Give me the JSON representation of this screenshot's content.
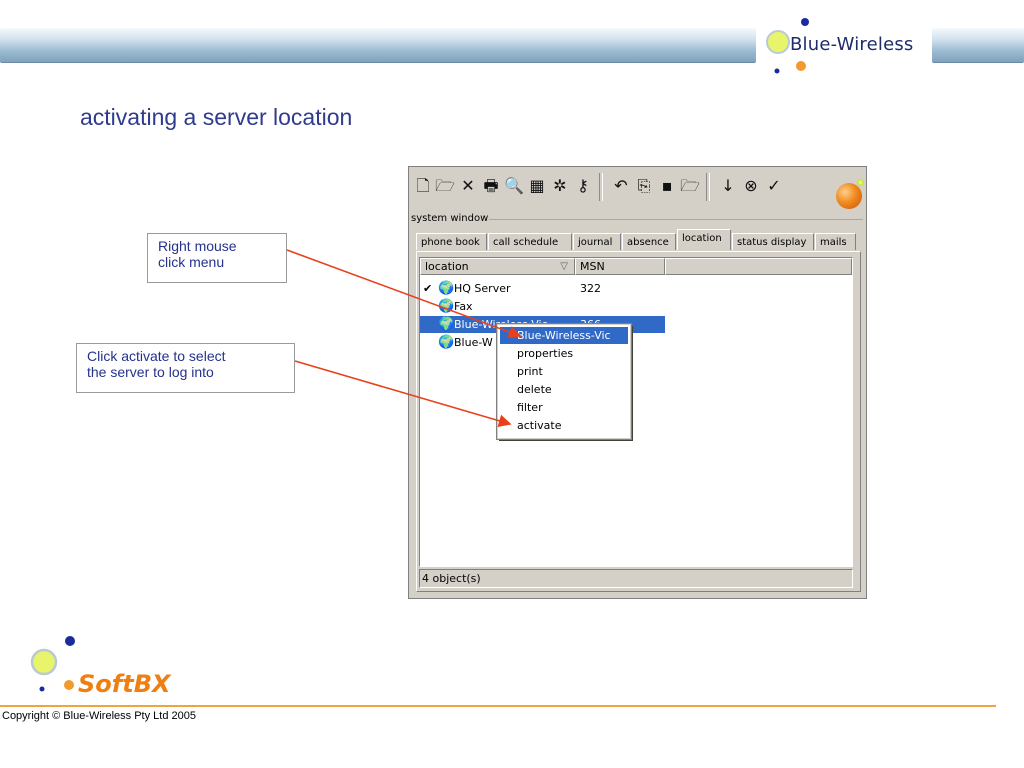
{
  "header": {
    "brand_text": "Blue-Wireless"
  },
  "slide": {
    "title": "activating a server location"
  },
  "callouts": {
    "right_click": "Right mouse\nclick menu",
    "activate": "Click activate to select\nthe server to log into"
  },
  "window": {
    "system_caption": "system window",
    "toolbar_icons": [
      "new-document-icon",
      "open-folder-icon",
      "delete-icon",
      "print-icon",
      "search-icon",
      "calculator-icon",
      "settings-icon",
      "key-icon",
      "undo-icon",
      "copy-icon",
      "save-icon",
      "open-icon",
      "down-arrow-icon",
      "cancel-icon",
      "check-icon",
      "orb-icon"
    ],
    "tabs": [
      "phone book",
      "call schedule",
      "journal",
      "absence",
      "location",
      "status display",
      "mails"
    ],
    "active_tab": "location",
    "columns": {
      "location": "location",
      "msn": "MSN"
    },
    "rows": [
      {
        "check": "✔",
        "name": "HQ Server",
        "msn": "322"
      },
      {
        "check": "",
        "name": "Fax",
        "msn": ""
      },
      {
        "check": "",
        "name": "Blue-Wireless-Vic",
        "msn": "366"
      },
      {
        "check": "",
        "name": "Blue-W",
        "msn": ""
      }
    ],
    "status": "4 object(s)"
  },
  "context_menu": {
    "items": [
      "Blue-Wireless-Vic",
      "properties",
      "print",
      "delete",
      "filter",
      "activate"
    ],
    "highlighted": "Blue-Wireless-Vic"
  },
  "footer": {
    "product": "SoftBX",
    "copyright": "Copyright © Blue-Wireless Pty Ltd 2005"
  },
  "colors": {
    "accent_blue": "#2f3b8c",
    "selection": "#3169c6",
    "arrow_red": "#e8401c",
    "orange": "#f07f12"
  }
}
